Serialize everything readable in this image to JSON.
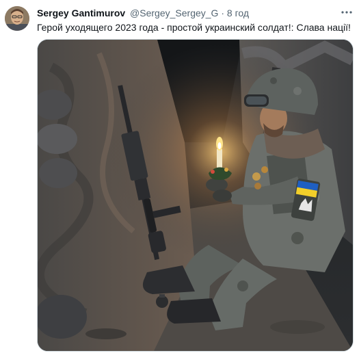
{
  "tweet": {
    "author_name": "Sergey Gantimurov",
    "author_handle": "@Sergey_Sergey_G",
    "separator": "·",
    "timestamp": "8 год",
    "text": "Герой уходящего 2023 года - простой украинский солдат!:  Слава нації!"
  },
  "icons": {
    "avatar": "user-avatar",
    "more": "more-horizontal-icon"
  },
  "colors": {
    "flag_blue": "#1f5fc2",
    "flag_yellow": "#f3cf2a",
    "border": "#cfd9de",
    "secondary_text": "#536471"
  }
}
